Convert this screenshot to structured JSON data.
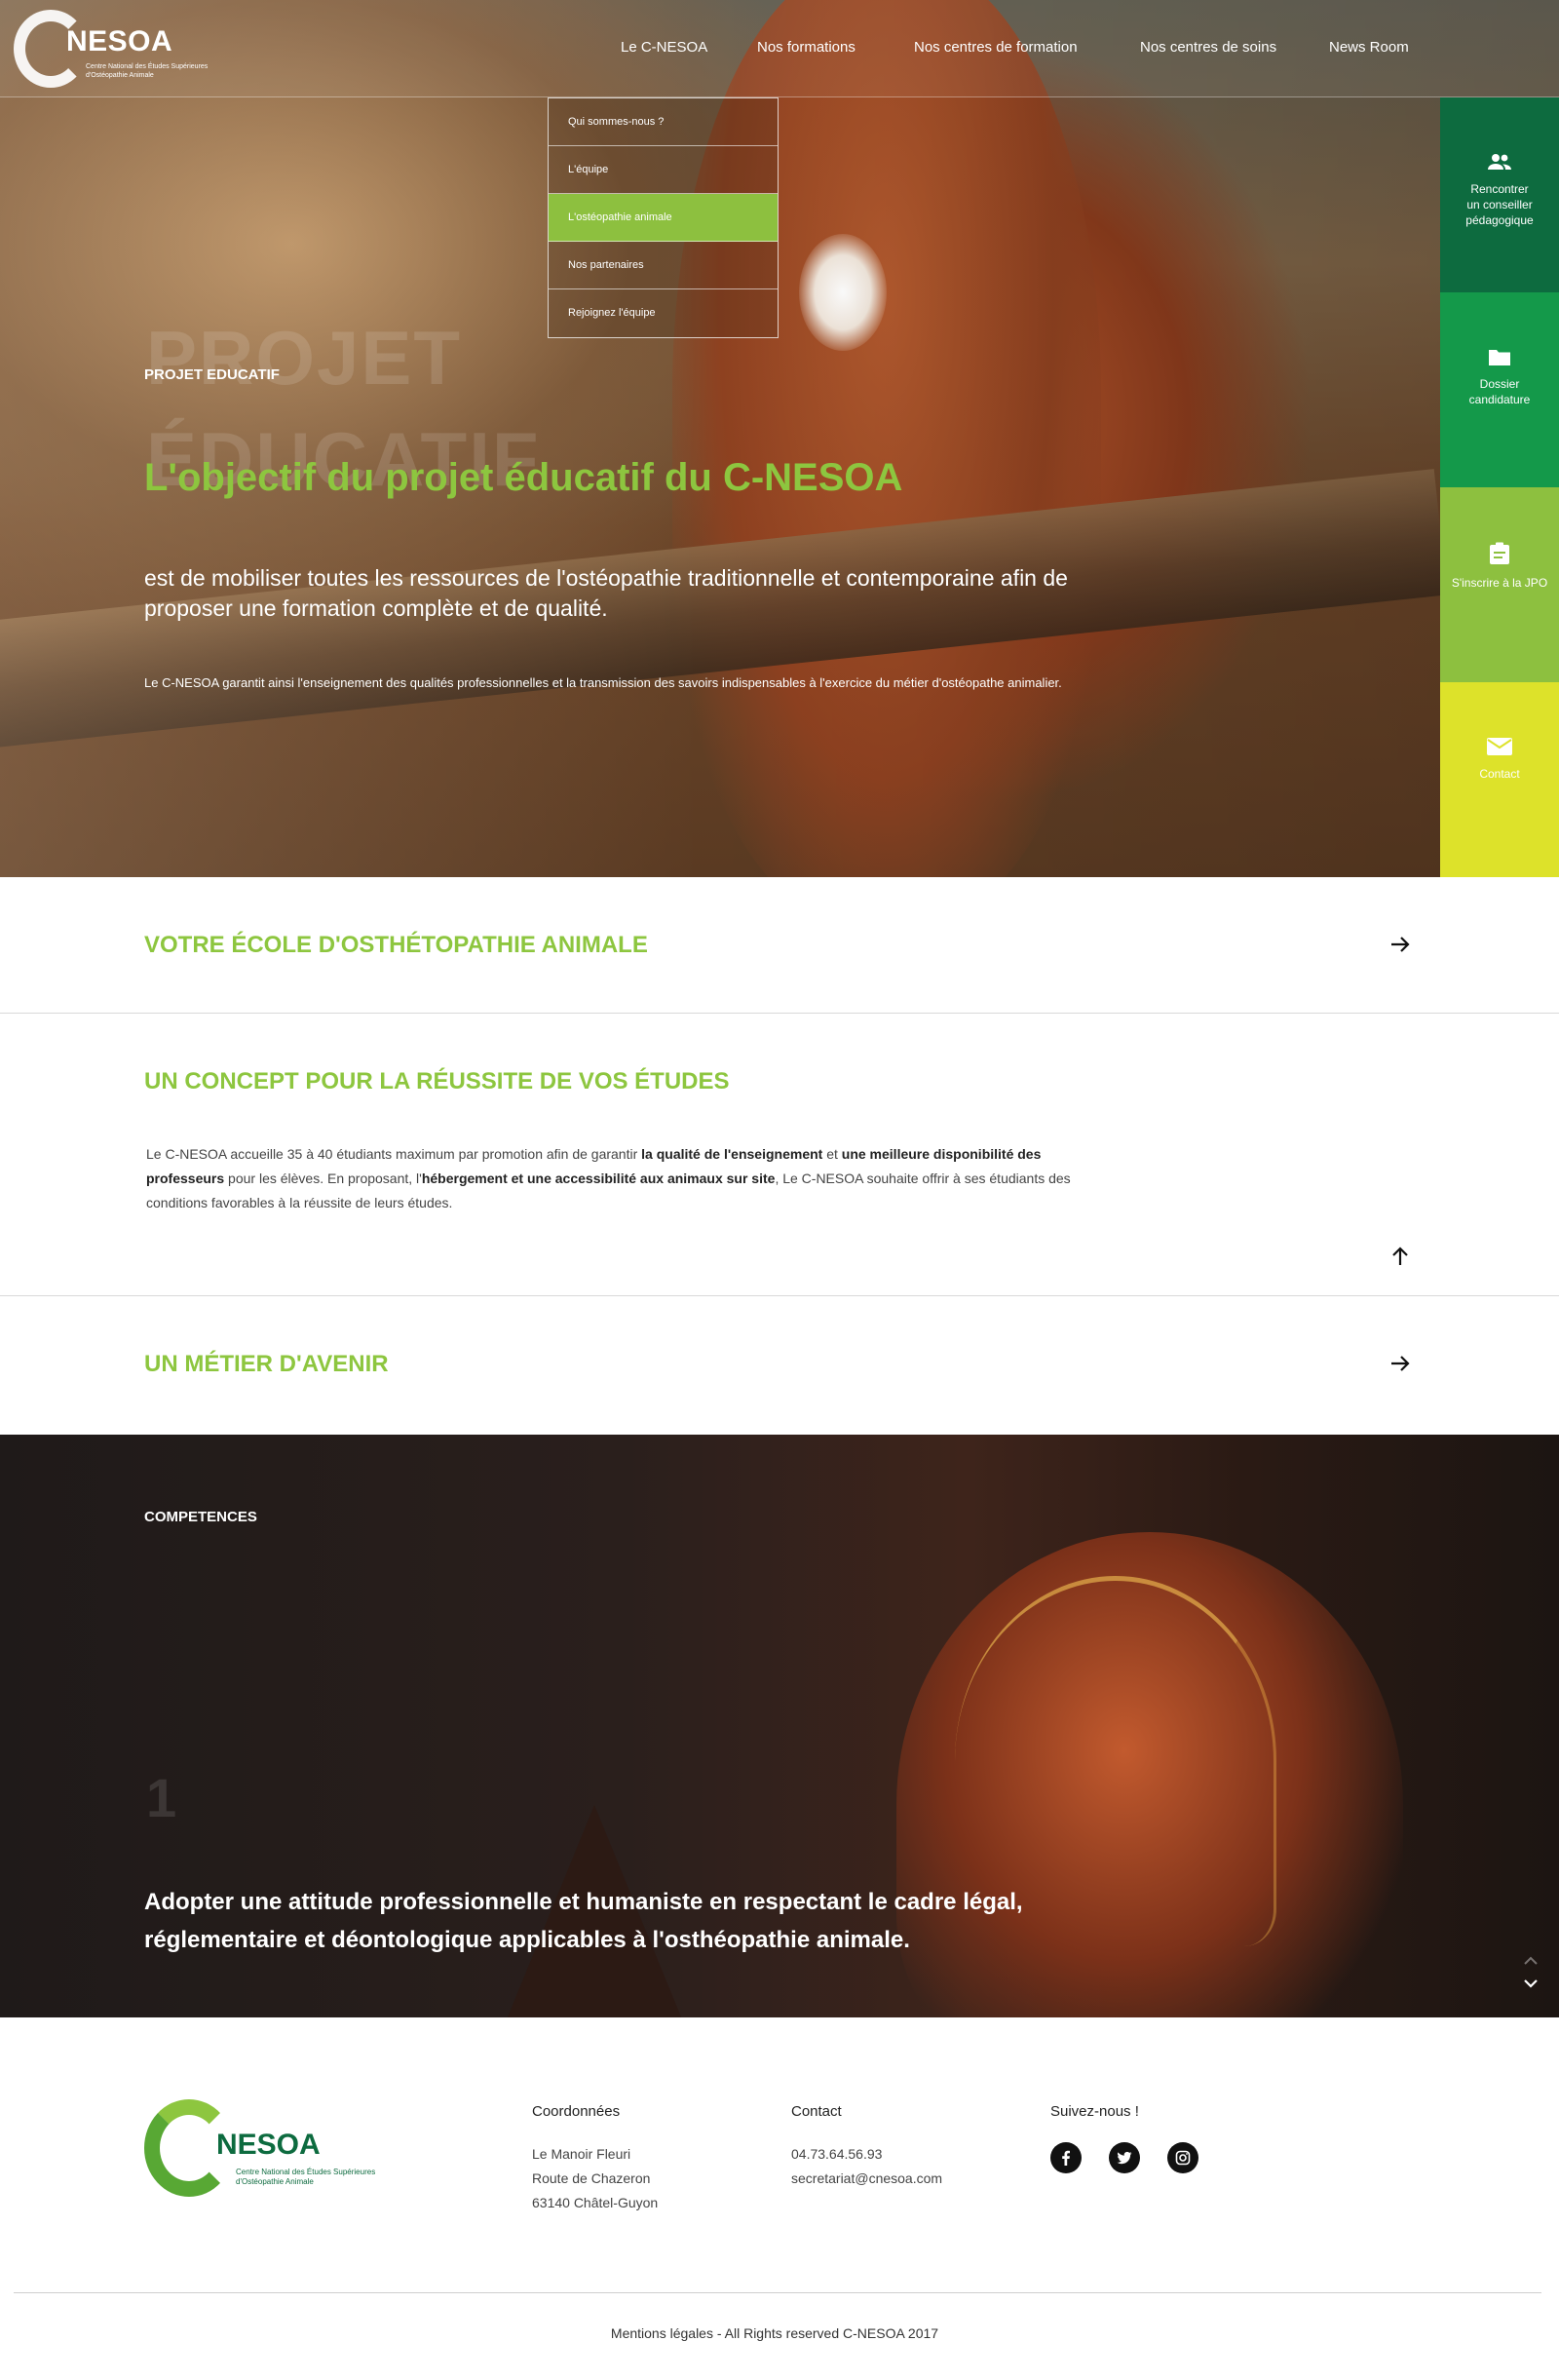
{
  "header": {
    "logo_name": "NESOA",
    "logo_tagline": "Centre National des Études Supérieures d'Ostéopathie Animale",
    "nav": [
      {
        "label": "Le C-NESOA"
      },
      {
        "label": "Nos formations"
      },
      {
        "label": "Nos centres de formation"
      },
      {
        "label": "Nos centres de soins"
      },
      {
        "label": "News Room"
      }
    ],
    "dropdown": [
      {
        "label": "Qui sommes-nous ?"
      },
      {
        "label": "L'équipe"
      },
      {
        "label": "L'ostéopathie animale"
      },
      {
        "label": "Nos partenaires"
      },
      {
        "label": "Rejoignez l'équipe"
      }
    ]
  },
  "hero": {
    "watermark_line1": "PROJET",
    "watermark_line2": "ÉDUCATIF",
    "kicker": "PROJET EDUCATIF",
    "title": "L'objectif du projet éducatif du C-NESOA",
    "lead": "est de mobiliser toutes les ressources de l'ostéopathie traditionnelle et contemporaine afin de proposer une formation complète et de qualité.",
    "small": "Le C-NESOA garantit ainsi l'enseignement des qualités professionnelles  et la transmission des savoirs indispensables à l'exercice du métier d'ostéopathe animalier."
  },
  "side_actions": [
    {
      "line1": "Rencontrer",
      "line2": "un conseiller",
      "line3": "pédagogique",
      "icon": "people-icon"
    },
    {
      "line1": "Dossier",
      "line2": "candidature",
      "line3": "",
      "icon": "folder-icon"
    },
    {
      "line1": "S'inscrire à la JPO",
      "line2": "",
      "line3": "",
      "icon": "clipboard-icon"
    },
    {
      "line1": "Contact",
      "line2": "",
      "line3": "",
      "icon": "envelope-icon"
    }
  ],
  "sections": {
    "school": {
      "title": "VOTRE ÉCOLE D'OSTHÉTOPATHIE ANIMALE"
    },
    "concept": {
      "title": "UN CONCEPT POUR LA RÉUSSITE DE VOS ÉTUDES",
      "p1": "Le C-NESOA accueille 35 à 40 étudiants maximum par promotion afin de garantir ",
      "b1": "la qualité de l'enseignement",
      "p2": " et ",
      "b2": "une meilleure disponibilité des professeurs",
      "p3": " pour les élèves. En proposant, l'",
      "b3": "hébergement et une accessibilité aux animaux sur site",
      "p4": ", Le C-NESOA souhaite offrir à ses étudiants des conditions favorables à la réussite de leurs études."
    },
    "career": {
      "title": "UN MÉTIER D'AVENIR"
    }
  },
  "competences": {
    "kicker": "COMPETENCES",
    "number": "1",
    "text": "Adopter une attitude professionnelle et humaniste en respectant le cadre légal, réglementaire et déontologique applicables à l'osthéopathie animale."
  },
  "footer": {
    "logo_name": "NESOA",
    "logo_tagline": "Centre National des Études Supérieures d'Ostéopathie Animale",
    "coords_heading": "Coordonnées",
    "coords": [
      "Le Manoir Fleuri",
      "Route de Chazeron",
      "63140 Châtel-Guyon"
    ],
    "contact_heading": "Contact",
    "contact": [
      "04.73.64.56.93",
      "secretariat@cnesoa.com"
    ],
    "social_heading": "Suivez-nous !",
    "social": [
      "facebook-icon",
      "twitter-icon",
      "instagram-icon"
    ],
    "copyright": "Mentions légales - All Rights reserved C-NESOA 2017"
  },
  "colors": {
    "accent_green": "#8dc63f",
    "dark_green": "#0d6b3f",
    "mid_green": "#14994a",
    "lime": "#dde22a"
  }
}
